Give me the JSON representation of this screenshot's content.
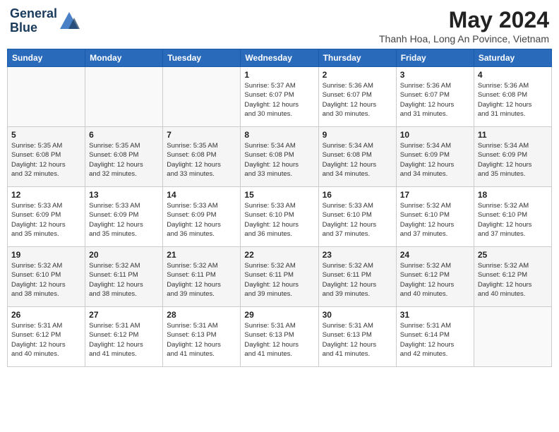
{
  "header": {
    "logo_line1": "General",
    "logo_line2": "Blue",
    "main_title": "May 2024",
    "subtitle": "Thanh Hoa, Long An Povince, Vietnam"
  },
  "calendar": {
    "weekdays": [
      "Sunday",
      "Monday",
      "Tuesday",
      "Wednesday",
      "Thursday",
      "Friday",
      "Saturday"
    ],
    "weeks": [
      [
        {
          "day": "",
          "info": ""
        },
        {
          "day": "",
          "info": ""
        },
        {
          "day": "",
          "info": ""
        },
        {
          "day": "1",
          "info": "Sunrise: 5:37 AM\nSunset: 6:07 PM\nDaylight: 12 hours\nand 30 minutes."
        },
        {
          "day": "2",
          "info": "Sunrise: 5:36 AM\nSunset: 6:07 PM\nDaylight: 12 hours\nand 30 minutes."
        },
        {
          "day": "3",
          "info": "Sunrise: 5:36 AM\nSunset: 6:07 PM\nDaylight: 12 hours\nand 31 minutes."
        },
        {
          "day": "4",
          "info": "Sunrise: 5:36 AM\nSunset: 6:08 PM\nDaylight: 12 hours\nand 31 minutes."
        }
      ],
      [
        {
          "day": "5",
          "info": "Sunrise: 5:35 AM\nSunset: 6:08 PM\nDaylight: 12 hours\nand 32 minutes."
        },
        {
          "day": "6",
          "info": "Sunrise: 5:35 AM\nSunset: 6:08 PM\nDaylight: 12 hours\nand 32 minutes."
        },
        {
          "day": "7",
          "info": "Sunrise: 5:35 AM\nSunset: 6:08 PM\nDaylight: 12 hours\nand 33 minutes."
        },
        {
          "day": "8",
          "info": "Sunrise: 5:34 AM\nSunset: 6:08 PM\nDaylight: 12 hours\nand 33 minutes."
        },
        {
          "day": "9",
          "info": "Sunrise: 5:34 AM\nSunset: 6:08 PM\nDaylight: 12 hours\nand 34 minutes."
        },
        {
          "day": "10",
          "info": "Sunrise: 5:34 AM\nSunset: 6:09 PM\nDaylight: 12 hours\nand 34 minutes."
        },
        {
          "day": "11",
          "info": "Sunrise: 5:34 AM\nSunset: 6:09 PM\nDaylight: 12 hours\nand 35 minutes."
        }
      ],
      [
        {
          "day": "12",
          "info": "Sunrise: 5:33 AM\nSunset: 6:09 PM\nDaylight: 12 hours\nand 35 minutes."
        },
        {
          "day": "13",
          "info": "Sunrise: 5:33 AM\nSunset: 6:09 PM\nDaylight: 12 hours\nand 35 minutes."
        },
        {
          "day": "14",
          "info": "Sunrise: 5:33 AM\nSunset: 6:09 PM\nDaylight: 12 hours\nand 36 minutes."
        },
        {
          "day": "15",
          "info": "Sunrise: 5:33 AM\nSunset: 6:10 PM\nDaylight: 12 hours\nand 36 minutes."
        },
        {
          "day": "16",
          "info": "Sunrise: 5:33 AM\nSunset: 6:10 PM\nDaylight: 12 hours\nand 37 minutes."
        },
        {
          "day": "17",
          "info": "Sunrise: 5:32 AM\nSunset: 6:10 PM\nDaylight: 12 hours\nand 37 minutes."
        },
        {
          "day": "18",
          "info": "Sunrise: 5:32 AM\nSunset: 6:10 PM\nDaylight: 12 hours\nand 37 minutes."
        }
      ],
      [
        {
          "day": "19",
          "info": "Sunrise: 5:32 AM\nSunset: 6:10 PM\nDaylight: 12 hours\nand 38 minutes."
        },
        {
          "day": "20",
          "info": "Sunrise: 5:32 AM\nSunset: 6:11 PM\nDaylight: 12 hours\nand 38 minutes."
        },
        {
          "day": "21",
          "info": "Sunrise: 5:32 AM\nSunset: 6:11 PM\nDaylight: 12 hours\nand 39 minutes."
        },
        {
          "day": "22",
          "info": "Sunrise: 5:32 AM\nSunset: 6:11 PM\nDaylight: 12 hours\nand 39 minutes."
        },
        {
          "day": "23",
          "info": "Sunrise: 5:32 AM\nSunset: 6:11 PM\nDaylight: 12 hours\nand 39 minutes."
        },
        {
          "day": "24",
          "info": "Sunrise: 5:32 AM\nSunset: 6:12 PM\nDaylight: 12 hours\nand 40 minutes."
        },
        {
          "day": "25",
          "info": "Sunrise: 5:32 AM\nSunset: 6:12 PM\nDaylight: 12 hours\nand 40 minutes."
        }
      ],
      [
        {
          "day": "26",
          "info": "Sunrise: 5:31 AM\nSunset: 6:12 PM\nDaylight: 12 hours\nand 40 minutes."
        },
        {
          "day": "27",
          "info": "Sunrise: 5:31 AM\nSunset: 6:12 PM\nDaylight: 12 hours\nand 41 minutes."
        },
        {
          "day": "28",
          "info": "Sunrise: 5:31 AM\nSunset: 6:13 PM\nDaylight: 12 hours\nand 41 minutes."
        },
        {
          "day": "29",
          "info": "Sunrise: 5:31 AM\nSunset: 6:13 PM\nDaylight: 12 hours\nand 41 minutes."
        },
        {
          "day": "30",
          "info": "Sunrise: 5:31 AM\nSunset: 6:13 PM\nDaylight: 12 hours\nand 41 minutes."
        },
        {
          "day": "31",
          "info": "Sunrise: 5:31 AM\nSunset: 6:14 PM\nDaylight: 12 hours\nand 42 minutes."
        },
        {
          "day": "",
          "info": ""
        }
      ]
    ]
  }
}
